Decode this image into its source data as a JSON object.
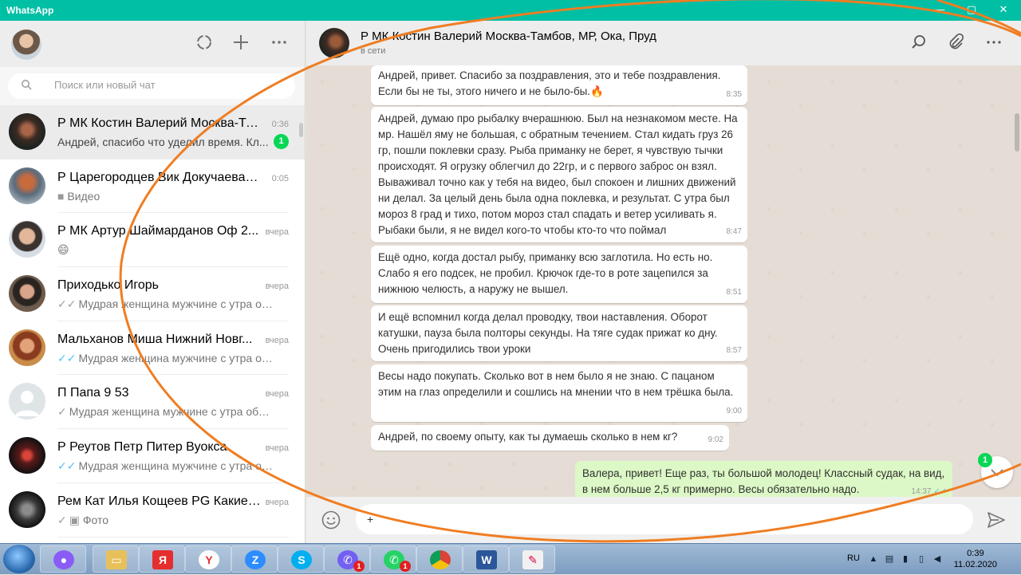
{
  "window": {
    "title": "WhatsApp",
    "min": "—",
    "max": "▢",
    "close": "✕"
  },
  "sidebar": {
    "search_placeholder": "Поиск или новый чат",
    "chats": [
      {
        "name": "Р МК Костин Валерий Москва-Та...",
        "time": "0:36",
        "preview": "Андрей, спасибо что уделил время. Кл...",
        "unread": "1",
        "tick": "",
        "active": true
      },
      {
        "name": "Р Царегородцев Вик Докучаева З...",
        "time": "0:05",
        "preview": "Видео",
        "unread": "",
        "tick": ""
      },
      {
        "name": "Р МК Артур Шаймарданов Оф 2...",
        "time": "вчера",
        "preview": "😄",
        "unread": "",
        "tick": ""
      },
      {
        "name": "Приходько Игорь",
        "time": "вчера",
        "preview": "Мудрая женщина мужчине с утра обяза...",
        "unread": "",
        "tick": "✓✓"
      },
      {
        "name": "Мальханов Миша Нижний Новг...",
        "time": "вчера",
        "preview": "Мудрая женщина мужчине с утра обяза...",
        "unread": "",
        "tick": "✓✓",
        "tick_color": "blue"
      },
      {
        "name": "П Папа 9 53",
        "time": "вчера",
        "preview": "Мудрая женщина мужчине с утра обязат...",
        "unread": "",
        "tick": "✓"
      },
      {
        "name": "Р Реутов Петр Питер Вуокса",
        "time": "вчера",
        "preview": "Мудрая женщина мужчине с утра обяза...",
        "unread": "",
        "tick": "✓✓",
        "tick_color": "blue"
      },
      {
        "name": "Рем Кат Илья Кощеев PG Какие ...",
        "time": "вчера",
        "preview": "Фото",
        "unread": "",
        "tick": "✓"
      }
    ]
  },
  "chat": {
    "title": "Р МК Костин Валерий Москва-Тамбов, МР, Ока, Пруд",
    "status": "в сети",
    "messages": [
      {
        "text": "Андрей, привет. Спасибо за поздравления, это и тебе поздравления. Если бы не ты, этого ничего и не было-бы.🔥",
        "time": "8:35"
      },
      {
        "text": "Андрей, думаю про рыбалку вчерашнюю. Был на незнакомом месте. На мр. Нашёл яму не большая, с обратным течением. Стал кидать груз 26 гр, пошли поклевки сразу. Рыба приманку не берет, я чувствую тычки происходят. Я огрузку облегчил до 22гр, и с первого заброс он взял. Вываживал точно как у тебя на видео, был спокоен и лишних движений ни делал. За целый день была одна поклевка, и результат. С утра был мороз 8 град и тихо, потом мороз стал спадать и ветер усиливать я. Рыбаки были, я не видел кого-то чтобы кто-то что поймал",
        "time": "8:47"
      },
      {
        "text": "Ещё одно, когда достал рыбу, приманку всю заглотила. Но есть но. Слабо я его подсек, не пробил. Крючок где-то в роте зацепился за нижнюю челюсть, а наружу не вышел.",
        "time": "8:51"
      },
      {
        "text": "И ещё вспомнил когда делал проводку, твои наставления. Оборот катушки, пауза была полторы секунды. На тяге судак прижат ко дну. Очень пригодились твои уроки",
        "time": "8:57"
      },
      {
        "text": "Весы надо покупать. Сколько вот в нем было я не знаю. С пацаном этим на глаз определили  и сошлись на мнении что в нем трёшка была.",
        "time": "9:00"
      },
      {
        "text": "Андрей, по своему опыту, как ты думаешь сколько в нем кг?",
        "time": "9:02"
      },
      {
        "text": "Валера, привет! Еще раз, ты большой молодец! Классный судак, на вид, в нем больше 2,5 кг примерно. Весы обязательно надо.",
        "time": "14:37",
        "out": true
      }
    ],
    "scroll_down_badge": "1",
    "composer_text": "+"
  },
  "taskbar": {
    "lang": "RU",
    "time": "0:39",
    "date": "11.02.2020",
    "viber_badge": "1",
    "whatsapp_badge": "1",
    "apps": [
      "start",
      "alice",
      "explorer",
      "yandex",
      "yandex-browser",
      "zoom",
      "skype",
      "viber",
      "whatsapp",
      "chrome",
      "word",
      "paint"
    ]
  },
  "colors": {
    "accent": "#00bfa5",
    "unread": "#06d755",
    "outgoing": "#dcf8c6",
    "annotation": "#ef7d22"
  }
}
